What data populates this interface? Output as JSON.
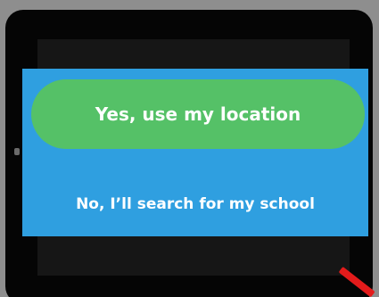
{
  "dialog": {
    "primary_label": "Yes, use my location",
    "secondary_label": "No, I’ll search for my school"
  },
  "colors": {
    "dialog_background": "#2f9fe0",
    "primary_button": "#55c167",
    "text": "#ffffff",
    "frame": "#050505",
    "corner_mark": "#e31b1b"
  },
  "icons": {
    "corner_mark": "red-stripe-icon"
  }
}
